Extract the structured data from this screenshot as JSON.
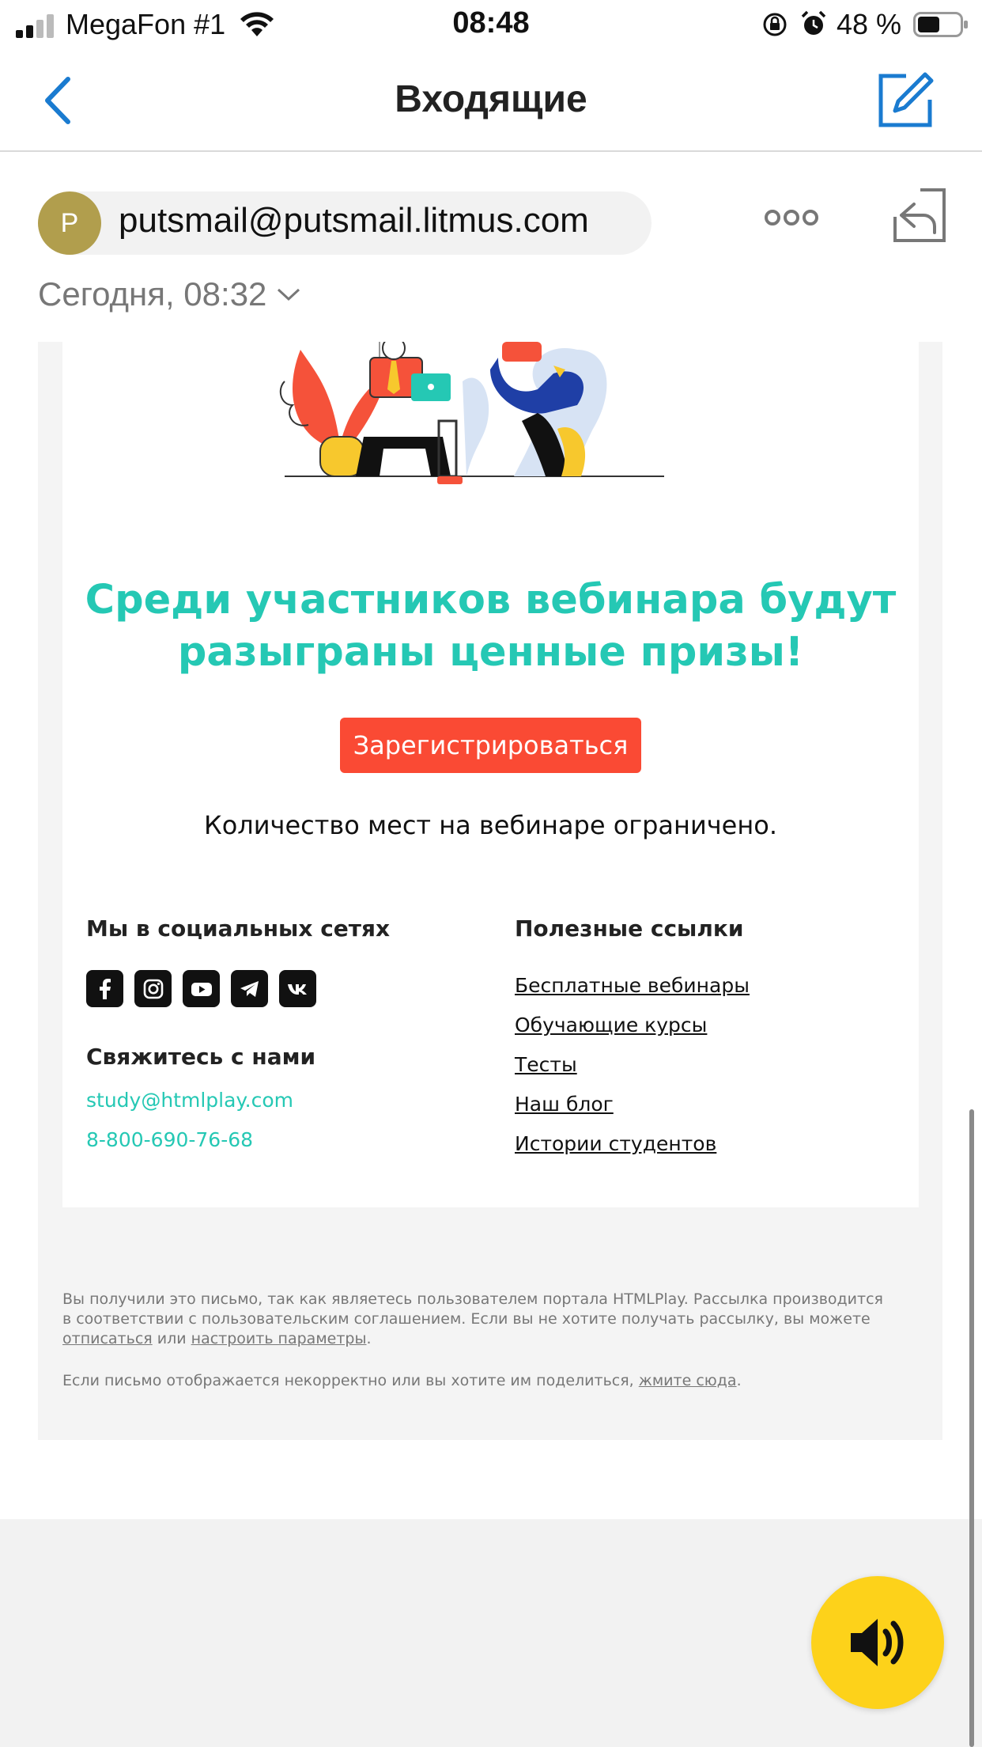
{
  "status_bar": {
    "carrier": "MegaFon #1",
    "time": "08:48",
    "battery": "48 %"
  },
  "nav": {
    "title": "Входящие"
  },
  "message": {
    "avatar_letter": "P",
    "sender": "putsmail@putsmail.litmus.com",
    "date": "Сегодня, 08:32"
  },
  "email": {
    "headline_line1": "Среди участников вебинара будут",
    "headline_line2": "разыграны ценные призы!",
    "register_label": "Зарегистрироваться",
    "limited_text": "Количество мест на вебинаре ограничено.",
    "social_title": "Мы в социальных сетях",
    "social_icons": [
      "facebook-icon",
      "instagram-icon",
      "youtube-icon",
      "telegram-icon",
      "vk-icon"
    ],
    "contact_title": "Свяжитесь с нами",
    "contact_email": "study@htmlplay.com",
    "contact_phone": "8-800-690-76-68",
    "links_title": "Полезные ссылки",
    "links": [
      "Бесплатные вебинары",
      "Обучающие курсы",
      "Тесты",
      "Наш блог",
      "Истории студентов"
    ],
    "footer_line1": "Вы получили это письмо, так как являетесь пользователем портала HTMLPlay. Рассылка производится",
    "footer_line2": "в соответствии с пользовательским соглашением. Если вы не хотите получать рассылку, вы можете",
    "footer_unsubscribe": "отписаться",
    "footer_or": "или",
    "footer_settings": "настроить параметры",
    "footer_share": "Если письмо отображается некорректно или вы хотите им поделиться,",
    "footer_click_here": "жмите сюда"
  },
  "colors": {
    "accent_teal": "#25c8b4",
    "button_red": "#fa4a34",
    "ios_blue": "#1a7bd0",
    "speaker_yellow": "#fdd21a"
  }
}
